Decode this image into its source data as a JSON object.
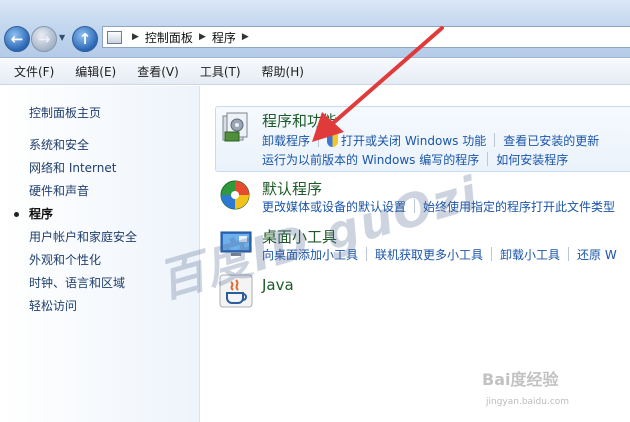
{
  "breadcrumb": [
    "控制面板",
    "程序"
  ],
  "menu": [
    "文件(F)",
    "编辑(E)",
    "查看(V)",
    "工具(T)",
    "帮助(H)"
  ],
  "sidebar": {
    "home": "控制面板主页",
    "items": [
      {
        "label": "系统和安全",
        "active": false
      },
      {
        "label": "网络和 Internet",
        "active": false
      },
      {
        "label": "硬件和声音",
        "active": false
      },
      {
        "label": "程序",
        "active": true
      },
      {
        "label": "用户帐户和家庭安全",
        "active": false
      },
      {
        "label": "外观和个性化",
        "active": false
      },
      {
        "label": "时钟、语言和区域",
        "active": false
      },
      {
        "label": "轻松访问",
        "active": false
      }
    ]
  },
  "categories": {
    "programs": {
      "title": "程序和功能",
      "links_row1": [
        "卸载程序",
        "打开或关闭 Windows 功能",
        "查看已安装的更新"
      ],
      "links_row2": [
        "运行为以前版本的 Windows 编写的程序",
        "如何安装程序"
      ]
    },
    "defaults": {
      "title": "默认程序",
      "links": [
        "更改媒体或设备的默认设置",
        "始终使用指定的程序打开此文件类型"
      ]
    },
    "gadgets": {
      "title": "桌面小工具",
      "links": [
        "向桌面添加小工具",
        "联机获取更多小工具",
        "卸载小工具",
        "还原 W"
      ]
    },
    "java": {
      "title": "Java"
    }
  },
  "watermark": "百度ID guOzi",
  "watermark_logo": "Bai度经验",
  "watermark_url": "jingyan.baidu.com",
  "colors": {
    "link": "#1a55a8",
    "title_green": "#1e5a28",
    "annotation_arrow": "#e03a3a"
  }
}
